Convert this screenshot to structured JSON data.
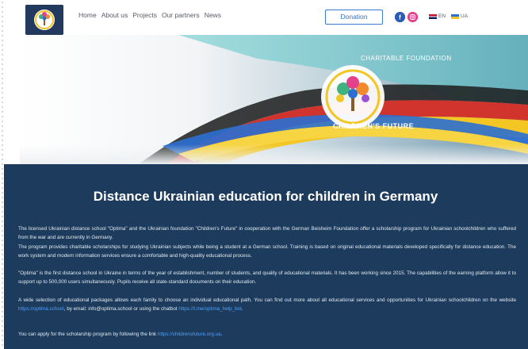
{
  "nav": {
    "items": [
      "Home",
      "About us",
      "Projects",
      "Our partners",
      "News"
    ]
  },
  "header": {
    "donate_label": "Donation",
    "lang_en": "EN",
    "lang_ua": "UA"
  },
  "hero": {
    "logo_arc_text": "CHARITABLE FOUNDATION",
    "logo_bottom_text": "CHILDREN'S FUTURE"
  },
  "main": {
    "title": "Distance Ukrainian education for children in Germany",
    "p1": "The licensed Ukrainian distance school \"Optima\" and the Ukrainian foundation \"Children's Future\" in cooperation with the German Beisheim Foundation offer a scholarship program for Ukrainian schoolchildren who suffered from the war and are currently in Germany.",
    "p2": "The program provides charitable scholarships for studying Ukrainian subjects while being a student at a German school. Training is based on original educational materials developed specifically for distance education. The work system and modern information services ensure a comfortable and high-quality educational process.",
    "p3": "\"Optima\" is the first distance school in Ukraine in terms of the year of establishment, number of students, and quality of educational materials. It has been working since 2015. The capabilities of the earning platform allow it to support up to 500,000 users simultaneously. Pupils receive all state-standard documents on their education.",
    "p4_a": "A wide selection of educational packages allows each family to choose an individual educational path. You can find out more about all educational services and opportunities for Ukrainian schoolchildren on the website ",
    "p4_link1": "https://optima.school",
    "p4_b": ", by email: info@optima.school or using the chatbot ",
    "p4_link2": "https://t.me/optima_help_bot",
    "p4_c": ".",
    "p5_a": "You can apply for the scholarship program by following the link ",
    "p5_link": "https://childrensfuture.org.ua",
    "p5_b": "."
  },
  "colors": {
    "panel": "#1d3b5c",
    "accent": "#3a7bd5",
    "link": "#4ea1ff"
  },
  "icons": [
    "logo-icon",
    "facebook-icon",
    "instagram-icon",
    "flag-en-icon",
    "flag-ua-icon"
  ]
}
